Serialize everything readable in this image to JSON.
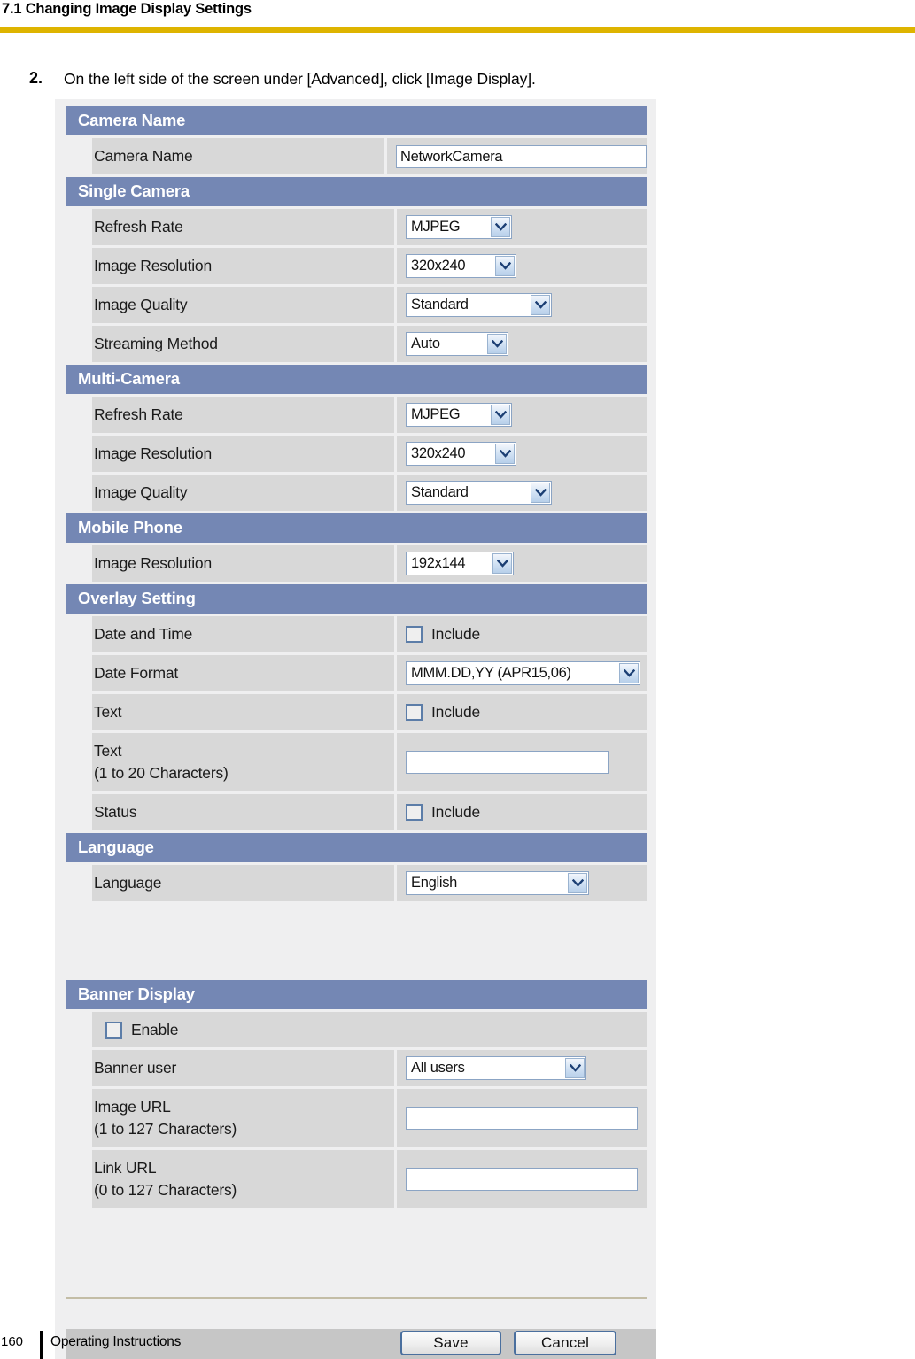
{
  "document": {
    "header_title": "7.1 Changing Image Display Settings",
    "step_number": "2.",
    "step_text": "On the left side of the screen under [Advanced], click [Image Display].",
    "page_number": "160",
    "footer_label": "Operating Instructions"
  },
  "colors": {
    "section_header_blue": "#7487b4",
    "rule_gold": "#deb400",
    "row_gray": "#d8d8d8",
    "panel_bg": "#efeff0",
    "footer_gray": "#c6c6c6",
    "divider_tan": "#c3bda6",
    "field_border_blue": "#8ba4c4"
  },
  "sections": {
    "camera_name": {
      "title": "Camera Name",
      "rows": [
        {
          "label": "Camera Name",
          "value": "NetworkCamera"
        }
      ]
    },
    "single_camera": {
      "title": "Single Camera",
      "rows": [
        {
          "label": "Refresh Rate",
          "value": "MJPEG"
        },
        {
          "label": "Image Resolution",
          "value": "320x240"
        },
        {
          "label": "Image Quality",
          "value": "Standard"
        },
        {
          "label": "Streaming Method",
          "value": "Auto"
        }
      ]
    },
    "multi_camera": {
      "title": "Multi-Camera",
      "rows": [
        {
          "label": "Refresh Rate",
          "value": "MJPEG"
        },
        {
          "label": "Image Resolution",
          "value": "320x240"
        },
        {
          "label": "Image Quality",
          "value": "Standard"
        }
      ]
    },
    "mobile_phone": {
      "title": "Mobile Phone",
      "rows": [
        {
          "label": "Image Resolution",
          "value": "192x144"
        }
      ]
    },
    "overlay_setting": {
      "title": "Overlay Setting",
      "rows": [
        {
          "label": "Date and Time",
          "value": "Include"
        },
        {
          "label": "Date Format",
          "value": "MMM.DD,YY (APR15,06)"
        },
        {
          "label": "Text",
          "value": "Include"
        },
        {
          "label": "Text\n(1 to 20 Characters)",
          "label_line1": "Text",
          "label_line2": "(1 to 20 Characters)",
          "value": ""
        },
        {
          "label": "Status",
          "value": "Include"
        }
      ]
    },
    "language": {
      "title": "Language",
      "rows": [
        {
          "label": "Language",
          "value": "English"
        }
      ]
    },
    "banner_display": {
      "title": "Banner Display",
      "enable_label": "Enable",
      "rows": [
        {
          "label": "Banner user",
          "value": "All users"
        },
        {
          "label_line1": "Image URL",
          "label_line2": "(1 to 127 Characters)",
          "value": ""
        },
        {
          "label_line1": "Link URL",
          "label_line2": "(0 to 127 Characters)",
          "value": ""
        }
      ]
    }
  },
  "buttons": {
    "save": "Save",
    "cancel": "Cancel"
  }
}
